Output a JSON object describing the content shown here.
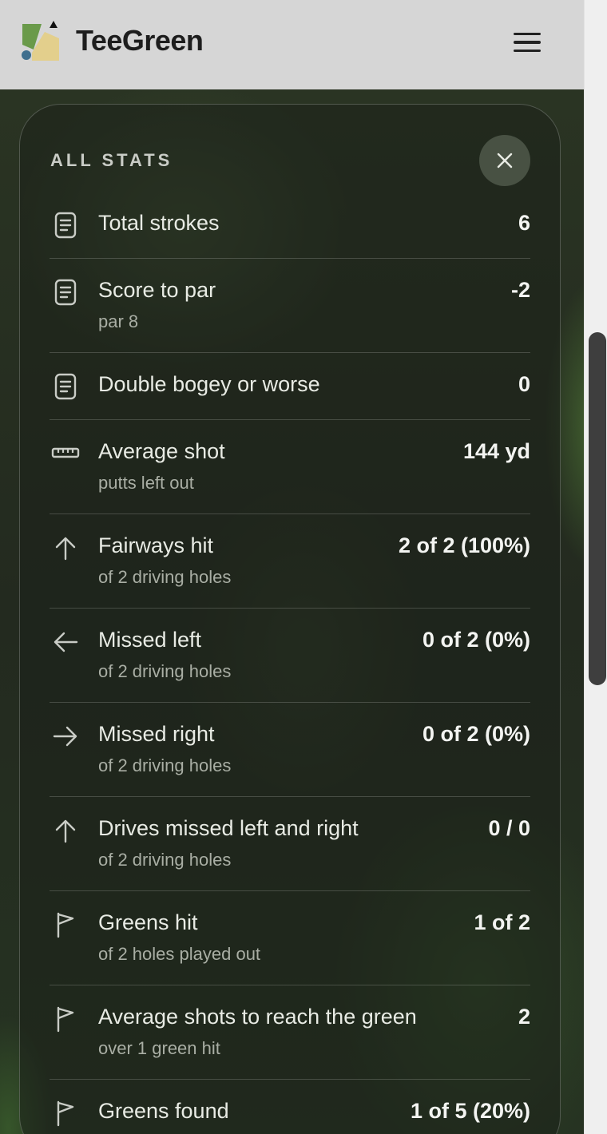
{
  "header": {
    "brand": "TeeGreen",
    "menu_icon": "hamburger-menu-icon"
  },
  "colors": {
    "header_bg": "#d6d6d6",
    "card_bg": "#1c201a",
    "text_primary": "#e8ebe4",
    "text_secondary": "#a9aea4",
    "logo_green": "#6a9a4a",
    "logo_yellow": "#e3cf8c",
    "logo_blue": "#3f6f8e"
  },
  "panel": {
    "title": "ALL STATS",
    "close_icon": "close-icon",
    "stats": [
      {
        "icon": "scorecard-icon",
        "label": "Total strokes",
        "sub": "",
        "value": "6"
      },
      {
        "icon": "scorecard-icon",
        "label": "Score to par",
        "sub": "par 8",
        "value": "-2"
      },
      {
        "icon": "scorecard-icon",
        "label": "Double bogey or worse",
        "sub": "",
        "value": "0"
      },
      {
        "icon": "ruler-icon",
        "label": "Average shot",
        "sub": "putts left out",
        "value": "144 yd"
      },
      {
        "icon": "arrow-up-icon",
        "label": "Fairways hit",
        "sub": "of 2 driving holes",
        "value": "2 of 2 (100%)"
      },
      {
        "icon": "arrow-left-icon",
        "label": "Missed left",
        "sub": "of 2 driving holes",
        "value": "0 of 2 (0%)"
      },
      {
        "icon": "arrow-right-icon",
        "label": "Missed right",
        "sub": "of 2 driving holes",
        "value": "0 of 2 (0%)"
      },
      {
        "icon": "arrow-up-icon",
        "label": "Drives missed left and right",
        "sub": "of 2 driving holes",
        "value": "0 / 0"
      },
      {
        "icon": "flag-icon",
        "label": "Greens hit",
        "sub": "of 2 holes played out",
        "value": "1 of 2"
      },
      {
        "icon": "flag-icon",
        "label": "Average shots to reach the green",
        "sub": "over 1 green hit",
        "value": "2"
      },
      {
        "icon": "flag-icon",
        "label": "Greens found",
        "sub": "",
        "value": "1 of 5 (20%)"
      }
    ]
  }
}
